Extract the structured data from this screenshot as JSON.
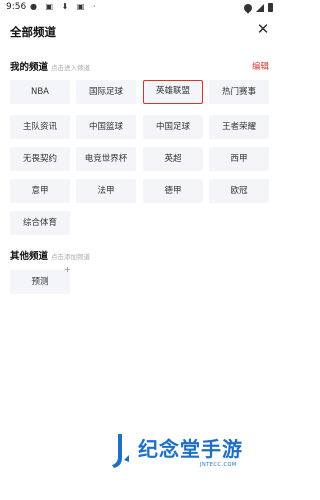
{
  "status_bar": {
    "time": "9:56",
    "notification_icons": "● ▣ ⬇ ▣ ·"
  },
  "header": {
    "title": "全部频道",
    "close_label": "✕"
  },
  "my_channels": {
    "title": "我的频道",
    "hint": "点击进入频道",
    "edit_label": "编辑",
    "items": [
      {
        "label": "NBA",
        "selected": false
      },
      {
        "label": "国际足球",
        "selected": false
      },
      {
        "label": "英雄联盟",
        "selected": true
      },
      {
        "label": "热门赛事",
        "selected": false
      },
      {
        "label": "主队资讯",
        "selected": false
      },
      {
        "label": "中国篮球",
        "selected": false
      },
      {
        "label": "中国足球",
        "selected": false
      },
      {
        "label": "王者荣耀",
        "selected": false
      },
      {
        "label": "无畏契约",
        "selected": false
      },
      {
        "label": "电竞世界杯",
        "selected": false
      },
      {
        "label": "英超",
        "selected": false
      },
      {
        "label": "西甲",
        "selected": false
      },
      {
        "label": "意甲",
        "selected": false
      },
      {
        "label": "法甲",
        "selected": false
      },
      {
        "label": "德甲",
        "selected": false
      },
      {
        "label": "欧冠",
        "selected": false
      },
      {
        "label": "综合体育",
        "selected": false
      }
    ]
  },
  "other_channels": {
    "title": "其他频道",
    "hint": "点击添加频道",
    "items": [
      {
        "label": "预测",
        "add_symbol": "+"
      }
    ]
  },
  "watermark": {
    "text": "纪念堂手游",
    "sub": "JNTECC.COM"
  },
  "colors": {
    "accent_red": "#d9322a",
    "chip_bg": "#f3f5f8",
    "watermark_blue": "#1f6fc7"
  }
}
